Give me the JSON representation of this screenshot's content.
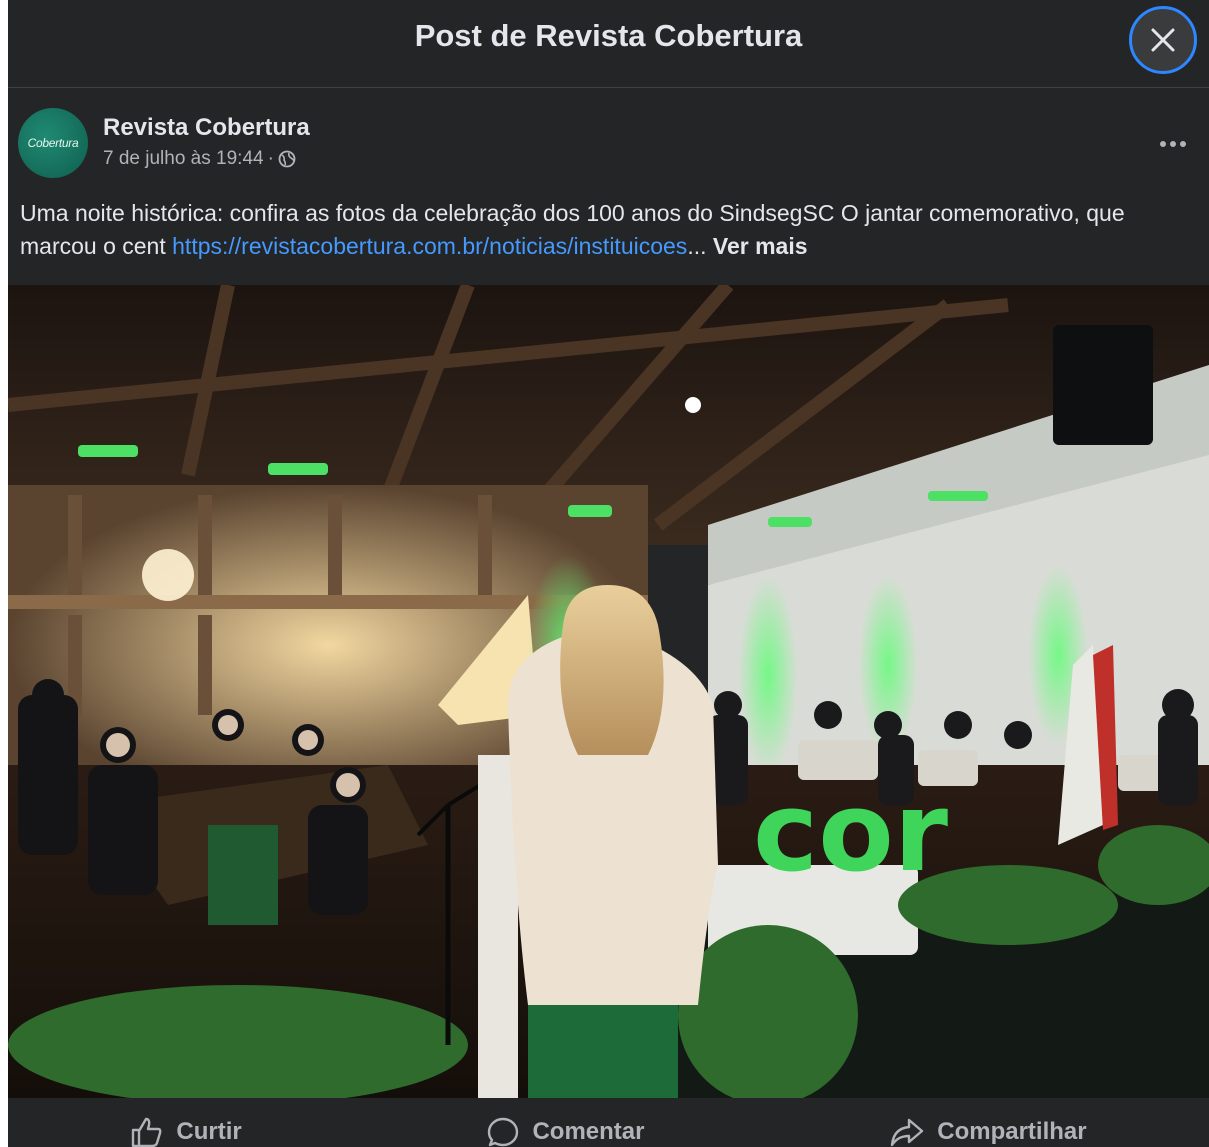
{
  "dialog": {
    "title": "Post de Revista Cobertura"
  },
  "post": {
    "author": "Revista Cobertura",
    "avatar_text": "Cobertura",
    "timestamp": "7 de julho às 19:44",
    "separator": "·",
    "text_main": "Uma noite histórica: confira as fotos da celebração dos 100 anos do SindsegSC O jantar comemorativo, que marcou o cent ",
    "link": "https://revistacobertura.com.br/noticias/instituicoes",
    "ellipsis": "...",
    "see_more": "Ver mais"
  },
  "actions": {
    "like": "Curtir",
    "comment": "Comentar",
    "share": "Compartilhar"
  },
  "photo": {
    "banner_letters": "cor"
  },
  "colors": {
    "background": "#242526",
    "text": "#e4e6eb",
    "muted": "#b0b3b8",
    "link": "#4599ff",
    "close_ring": "#2d88ff",
    "event_green": "#3fd45a"
  }
}
